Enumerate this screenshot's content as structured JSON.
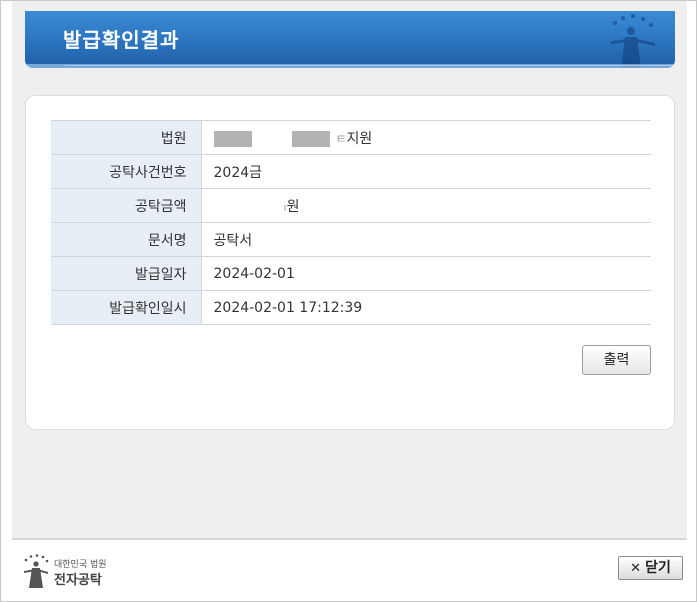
{
  "header": {
    "title": "발급확인결과"
  },
  "table": {
    "rows": [
      {
        "label": "법원",
        "value": "지원"
      },
      {
        "label": "공탁사건번호",
        "value": "2024금"
      },
      {
        "label": "공탁금액",
        "value": "원"
      },
      {
        "label": "문서명",
        "value": "공탁서"
      },
      {
        "label": "발급일자",
        "value": "2024-02-01"
      },
      {
        "label": "발급확인일시",
        "value": "2024-02-01 17:12:39"
      }
    ]
  },
  "actions": {
    "print_label": "출력"
  },
  "footer": {
    "org_line": "대한민국 법원",
    "service_name": "전자공탁",
    "close_label": "닫기",
    "close_icon": "close-icon"
  },
  "colors": {
    "header_blue": "#2f78c3",
    "label_bg": "#e8eef6",
    "mask_gray": "#b3b3b3"
  }
}
